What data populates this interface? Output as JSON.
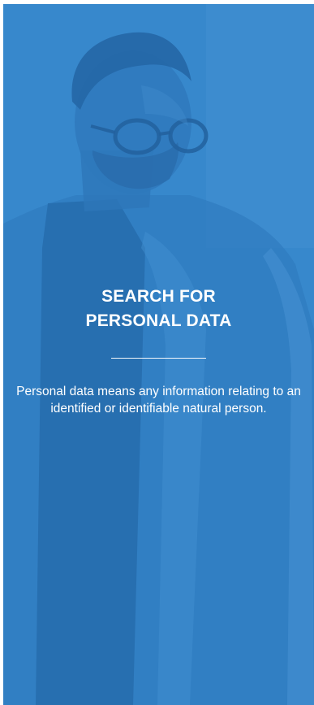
{
  "hero": {
    "title_line1": "SEARCH FOR",
    "title_line2": "PERSONAL DATA",
    "description": "Personal data means any information relating to an identified or identifiable natural person."
  },
  "colors": {
    "panel_blue": "#3786c8",
    "text": "#ffffff"
  },
  "background_image": "man-with-glasses-photo"
}
